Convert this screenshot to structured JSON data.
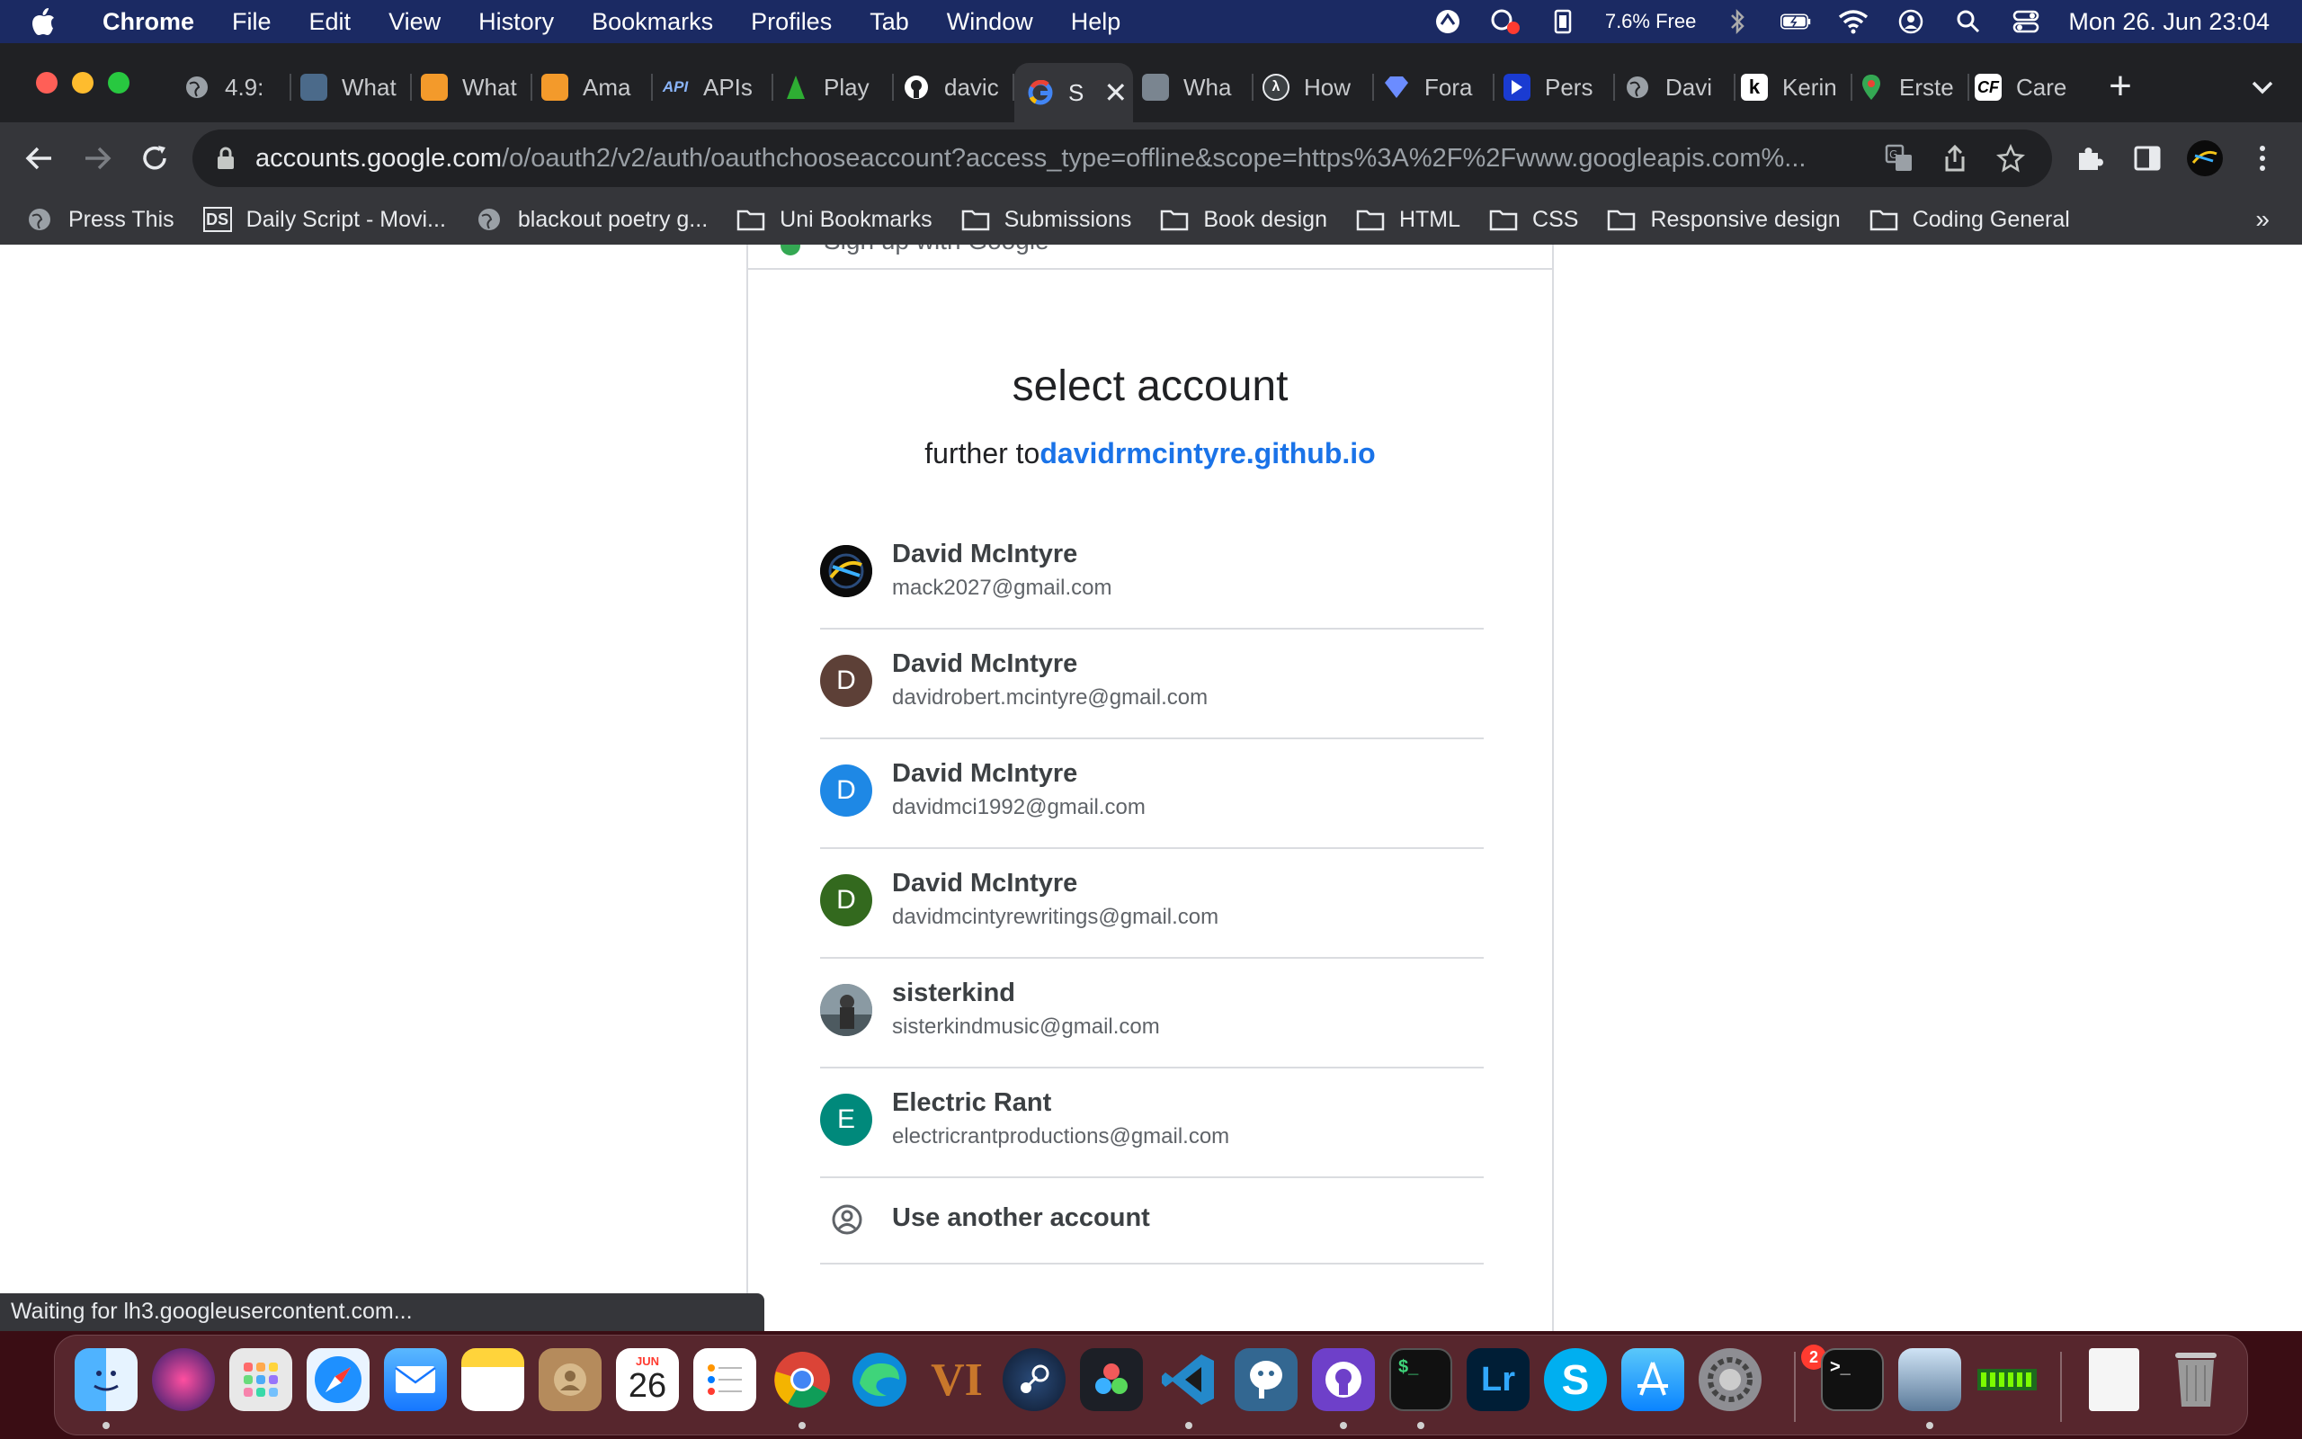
{
  "menubar": {
    "app": "Chrome",
    "items": [
      "File",
      "Edit",
      "View",
      "History",
      "Bookmarks",
      "Profiles",
      "Tab",
      "Window",
      "Help"
    ],
    "memory": "7.6% Free",
    "datetime": "Mon 26. Jun  23:04"
  },
  "tabs": [
    {
      "label": "4.9:",
      "icon": "globe-icon"
    },
    {
      "label": "What",
      "icon": "person-photo-icon"
    },
    {
      "label": "What",
      "icon": "orange-cube-icon"
    },
    {
      "label": "Ama",
      "icon": "orange-cube-icon"
    },
    {
      "label": "APIs",
      "icon": "api-icon"
    },
    {
      "label": "Play",
      "icon": "playwright-icon"
    },
    {
      "label": "davic",
      "icon": "github-icon"
    },
    {
      "label": "S",
      "icon": "google-icon",
      "active": true
    },
    {
      "label": "Wha",
      "icon": "photo-icon"
    },
    {
      "label": "How",
      "icon": "lambda-icon"
    },
    {
      "label": "Fora",
      "icon": "gem-icon"
    },
    {
      "label": "Pers",
      "icon": "arrow-icon"
    },
    {
      "label": "Davi",
      "icon": "globe-icon"
    },
    {
      "label": "Kerin",
      "icon": "k-icon"
    },
    {
      "label": "Erste",
      "icon": "maps-pin-icon"
    },
    {
      "label": "Care",
      "icon": "cf-icon"
    }
  ],
  "omnibox": {
    "host": "accounts.google.com",
    "path": "/o/oauth2/v2/auth/oauthchooseaccount?access_type=offline&scope=https%3A%2F%2Fwww.googleapis.com%..."
  },
  "bookmarks": [
    {
      "label": "Press This",
      "icon": "globe-icon"
    },
    {
      "label": "Daily Script - Movi...",
      "icon": "ds-icon"
    },
    {
      "label": "blackout poetry g...",
      "icon": "globe-icon"
    },
    {
      "label": "Uni Bookmarks",
      "icon": "folder-icon"
    },
    {
      "label": "Submissions",
      "icon": "folder-icon"
    },
    {
      "label": "Book design",
      "icon": "folder-icon"
    },
    {
      "label": "HTML",
      "icon": "folder-icon"
    },
    {
      "label": "CSS",
      "icon": "folder-icon"
    },
    {
      "label": "Responsive design",
      "icon": "folder-icon"
    },
    {
      "label": "Coding General",
      "icon": "folder-icon"
    }
  ],
  "bookmarks_more": "»",
  "page": {
    "cut_text": "Sign up with Google",
    "title": "select account",
    "subtitle_prefix": "further to",
    "subtitle_link": "davidrmcintyre.github.io",
    "accounts": [
      {
        "name": "David McIntyre",
        "email": "mack2027@gmail.com",
        "avatar": "",
        "color": "#000000",
        "image": true
      },
      {
        "name": "David McIntyre",
        "email": "davidrobert.mcintyre@gmail.com",
        "avatar": "D",
        "color": "#5d4037"
      },
      {
        "name": "David McIntyre",
        "email": "davidmci1992@gmail.com",
        "avatar": "D",
        "color": "#1e88e5"
      },
      {
        "name": "David McIntyre",
        "email": "davidmcintyrewritings@gmail.com",
        "avatar": "D",
        "color": "#33691e"
      },
      {
        "name": "sisterkind",
        "email": "sisterkindmusic@gmail.com",
        "avatar": "",
        "color": "#6d7a80",
        "image": true
      },
      {
        "name": "Electric Rant",
        "email": "electricrantproductions@gmail.com",
        "avatar": "E",
        "color": "#00897b"
      }
    ],
    "use_another": "Use another account"
  },
  "status": "Waiting for lh3.googleusercontent.com...",
  "dock": {
    "calendar_month": "JUN",
    "calendar_day": "26",
    "settings_badge": "2"
  }
}
